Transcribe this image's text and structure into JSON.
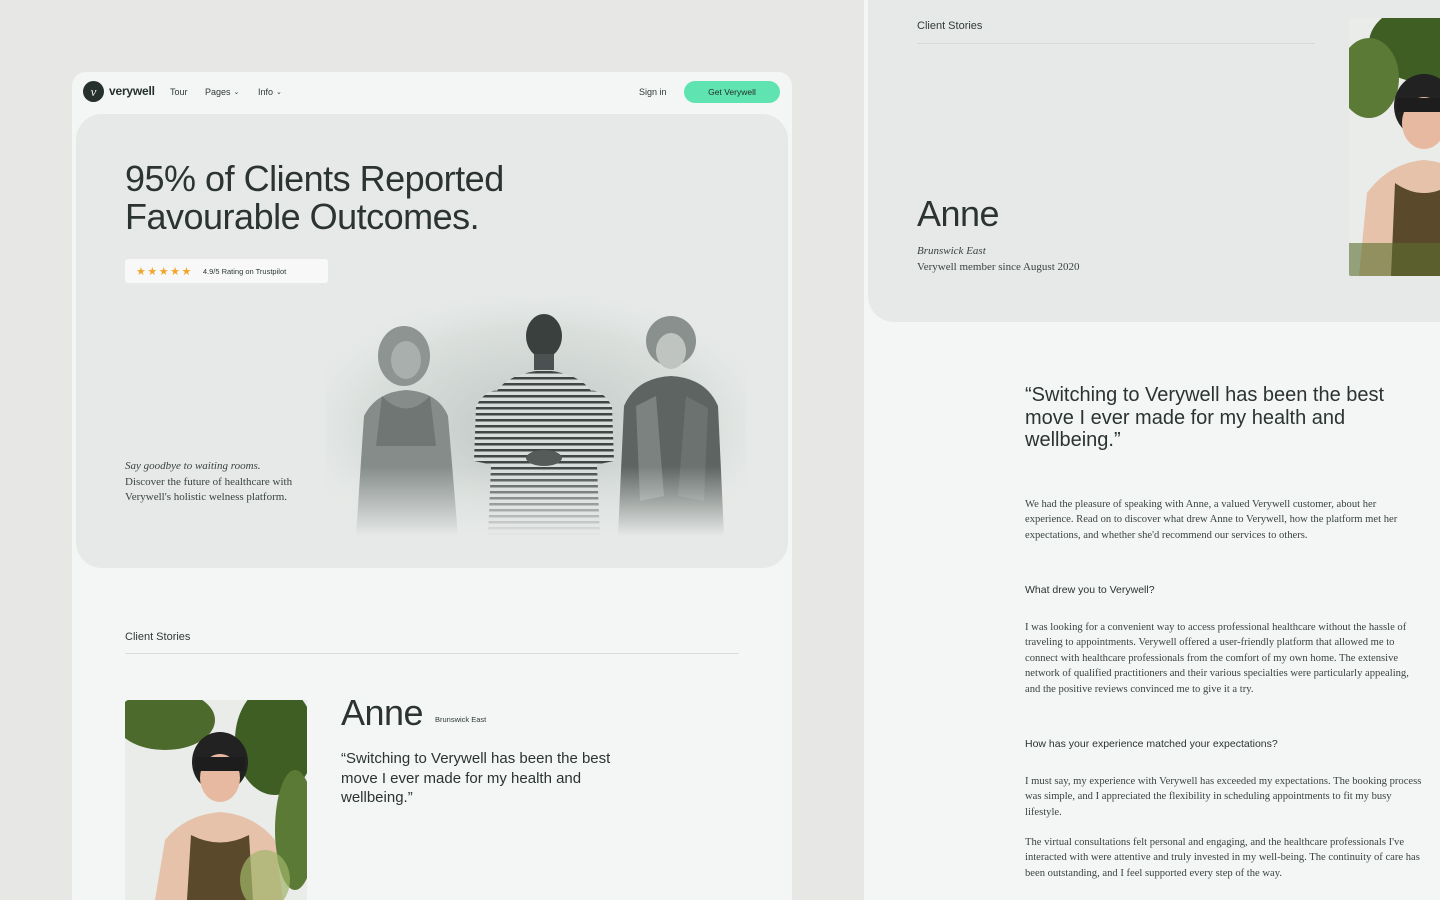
{
  "colors": {
    "background": "#e7e8e6",
    "panel": "#f4f6f5",
    "hero_bg": "#e6e9e7",
    "accent": "#5fe3b1",
    "text": "#2b3431",
    "star": "#f2a52a"
  },
  "nav": {
    "logo_icon": "verywell-logo-icon",
    "logo_text": "verywell",
    "tour": "Tour",
    "pages": "Pages",
    "info": "Info",
    "sign_in": "Sign in",
    "cta": "Get Verywell"
  },
  "hero": {
    "title": "95% of Clients Reported Favourable Outcomes.",
    "rating": {
      "stars": "★★★★★",
      "text": "4.9/5 Rating on Trustpilot"
    },
    "description_lead": "Say goodbye to waiting rooms.",
    "description": "Discover the future of healthcare with Verywell's holistic welness platform."
  },
  "stories": {
    "label": "Client Stories",
    "name": "Anne",
    "location": "Brunswick East",
    "quote": "“Switching to Verywell has been the best move I ever made for my health and wellbeing.”"
  },
  "detail": {
    "label": "Client Stories",
    "name": "Anne",
    "location": "Brunswick East",
    "member_since": "Verywell member since August 2020",
    "quote": "“Switching to Verywell has been the best move I ever made for my health and wellbeing.”",
    "intro": "We had the pleasure of speaking with Anne, a valued Verywell customer, about her experience. Read on to discover what drew Anne to Verywell, how the platform met her expectations, and whether she'd recommend our services to others.",
    "q1": "What drew you to Verywell?",
    "a1": "I was looking for a convenient way to access professional healthcare without the hassle of traveling to appointments. Verywell offered a user-friendly platform that allowed me to connect with healthcare professionals from the comfort of my own home. The extensive network of qualified practitioners and their various specialties were particularly appealing, and the positive reviews convinced me to give it a try.",
    "q2": "How has your experience matched your expectations?",
    "a2": "I must say, my experience with Verywell has exceeded my expectations. The booking process was simple, and I appreciated the flexibility in scheduling appointments to fit my busy lifestyle.",
    "a3": "The virtual consultations felt personal and engaging, and the healthcare professionals I've interacted with were attentive and truly invested in my well-being. The continuity of care has been outstanding, and I feel supported every step of the way."
  }
}
